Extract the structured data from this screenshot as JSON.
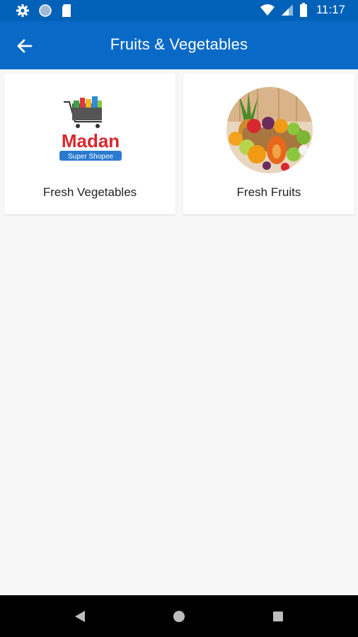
{
  "status_bar": {
    "time": "11:17",
    "icons": [
      "settings-icon",
      "circle-icon",
      "sd-card-icon",
      "wifi-icon",
      "signal-icon",
      "battery-icon"
    ]
  },
  "app_bar": {
    "title": "Fruits & Vegetables",
    "back_icon": "arrow-left-icon",
    "background_color": "#0969c6",
    "status_color": "#0061b8"
  },
  "categories": [
    {
      "label": "Fresh Vegetables",
      "image": "madan-super-shopee-logo",
      "logo_text": "Madan",
      "logo_subtext": "Super Shopee"
    },
    {
      "label": "Fresh Fruits",
      "image": "fruit-basket-photo"
    }
  ],
  "nav_bar": {
    "icons": [
      "back-triangle-icon",
      "home-circle-icon",
      "recents-square-icon"
    ]
  }
}
